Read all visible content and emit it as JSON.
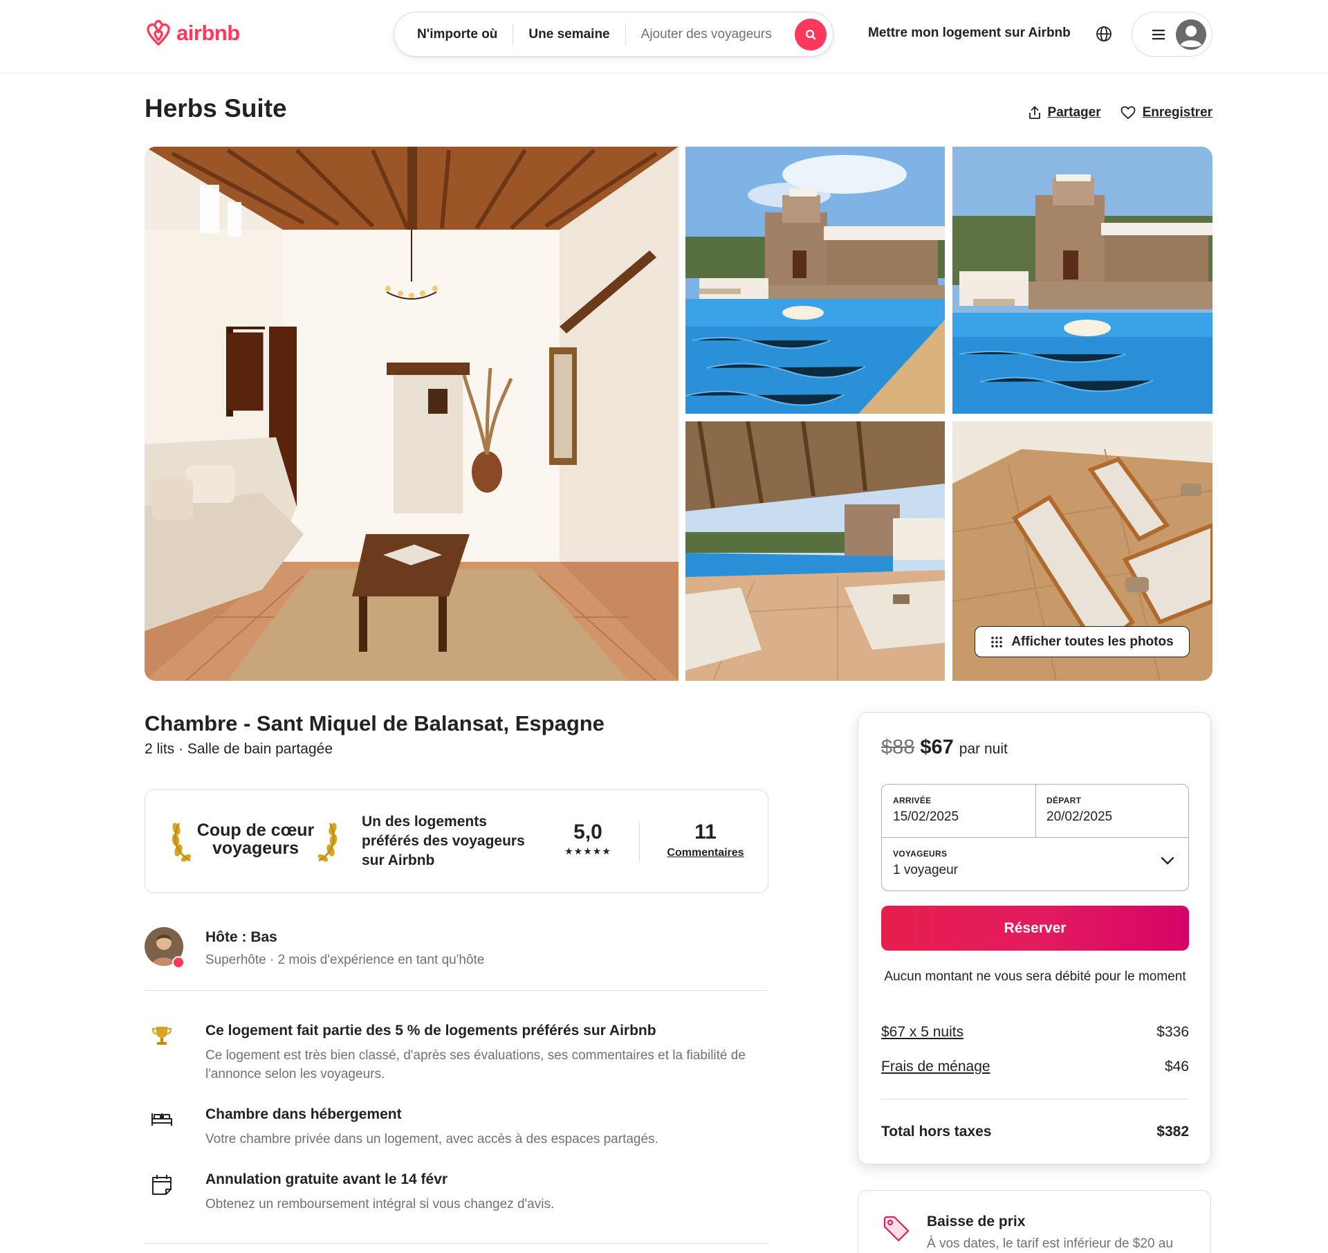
{
  "header": {
    "logo_text": "airbnb",
    "search": {
      "where": "N'importe où",
      "when": "Une semaine",
      "who_placeholder": "Ajouter des voyageurs"
    },
    "host_link": "Mettre mon logement sur Airbnb",
    "brand_color": "#ff385c"
  },
  "listing": {
    "title": "Herbs Suite",
    "share_label": "Partager",
    "save_label": "Enregistrer",
    "show_all_photos": "Afficher toutes les photos",
    "subtitle": "Chambre - Sant Miquel de Balansat, Espagne",
    "details": "2 lits · Salle de bain partagée"
  },
  "favorite": {
    "badge_line1": "Coup de cœur",
    "badge_line2": "voyageurs",
    "description": "Un des logements préférés des voyageurs sur Airbnb",
    "rating": "5,0",
    "stars": "★★★★★",
    "review_count": "11",
    "reviews_label": "Commentaires"
  },
  "host": {
    "name": "Hôte : Bas",
    "meta": "Superhôte · 2 mois d'expérience en tant qu'hôte"
  },
  "features": [
    {
      "icon": "trophy-icon",
      "title": "Ce logement fait partie des 5 % de logements préférés sur Airbnb",
      "description": "Ce logement est très bien classé, d'après ses évaluations, ses commentaires et la fiabilité de l'annonce selon les voyageurs."
    },
    {
      "icon": "bed-icon",
      "title": "Chambre dans hébergement",
      "description": "Votre chambre privée dans un logement, avec accès à des espaces partagés."
    },
    {
      "icon": "calendar-icon",
      "title": "Annulation gratuite avant le 14 févr",
      "description": "Obtenez un remboursement intégral si vous changez d'avis."
    }
  ],
  "booking": {
    "price_old": "$88",
    "price_new": "$67",
    "price_unit": "par nuit",
    "checkin_label": "ARRIVÉE",
    "checkin_value": "15/02/2025",
    "checkout_label": "DÉPART",
    "checkout_value": "20/02/2025",
    "guests_label": "VOYAGEURS",
    "guests_value": "1 voyageur",
    "reserve_label": "Réserver",
    "no_charge": "Aucun montant ne vous sera débité pour le moment",
    "fees": [
      {
        "label": "$67 x 5 nuits",
        "amount": "$336"
      },
      {
        "label": "Frais de ménage",
        "amount": "$46"
      }
    ],
    "total_label": "Total hors taxes",
    "total_amount": "$382"
  },
  "price_drop": {
    "title": "Baisse de prix",
    "text": "À vos dates, le tarif est inférieur de $20 au"
  }
}
